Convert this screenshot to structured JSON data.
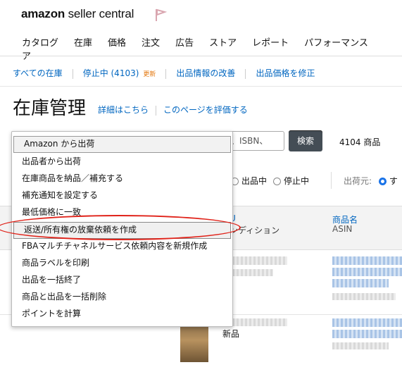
{
  "header": {
    "logo_bold": "amazon",
    "logo_light": " seller central",
    "nav": [
      "カタログ",
      "在庫",
      "価格",
      "注文",
      "広告",
      "ストア",
      "レポート",
      "パフォーマンス",
      "ア"
    ]
  },
  "subnav": {
    "all_inventory": "すべての在庫",
    "suspended": "停止中 (4103)",
    "updated": "更新",
    "improve_listings": "出品情報の改善",
    "fix_prices": "出品価格を修正"
  },
  "page": {
    "title": "在庫管理",
    "learn_more": "詳細はこちら",
    "rate_page": "このページを評価する"
  },
  "search": {
    "placeholder_visible": "、ISBN、",
    "button": "検索",
    "count": "4104 商品"
  },
  "filters": {
    "active": "出品中",
    "inactive": "停止中",
    "fulfilled_by_label": "出荷元:",
    "fulfilled_by_all": "す"
  },
  "table": {
    "col1_top": "U",
    "col1_bottom": "ンディション",
    "col2_top": "商品名",
    "col2_bottom": "ASIN",
    "row2_condition": "新品"
  },
  "dropdown": {
    "items": [
      "Amazon から出荷",
      "出品者から出荷",
      "在庫商品を納品／補充する",
      "補充通知を設定する",
      "最低価格に一致",
      "返送/所有権の放棄依頼を作成",
      "FBAマルチチャネルサービス依頼内容を新規作成",
      "商品ラベルを印刷",
      "出品を一括終了",
      "商品と出品を一括削除",
      "ポイントを計算"
    ],
    "selected_index": 0,
    "highlighted_index": 5
  },
  "colors": {
    "link": "#0066c0",
    "annotation_red": "#e0231a",
    "search_button": "#444d55",
    "badge_orange": "#e47911"
  }
}
